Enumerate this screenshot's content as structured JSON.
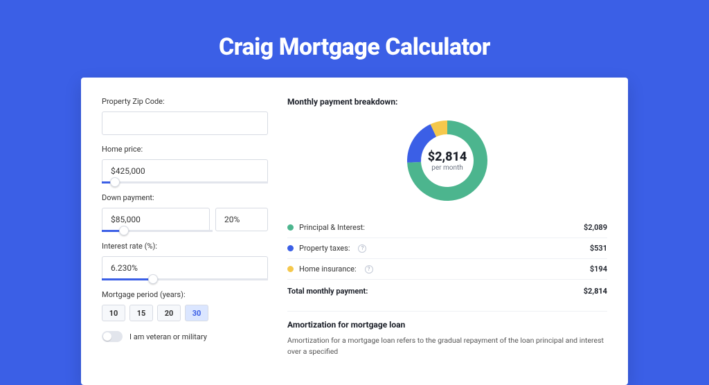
{
  "page": {
    "title": "Craig Mortgage Calculator"
  },
  "form": {
    "zip_label": "Property Zip Code:",
    "zip_value": "",
    "home_price_label": "Home price:",
    "home_price_value": "$425,000",
    "home_price_slider_pct": 8,
    "down_label": "Down payment:",
    "down_value": "$85,000",
    "down_pct_value": "20%",
    "down_slider_pct": 20,
    "rate_label": "Interest rate (%):",
    "rate_value": "6.230%",
    "rate_slider_pct": 31,
    "period_label": "Mortgage period (years):",
    "period_options": [
      "10",
      "15",
      "20",
      "30"
    ],
    "period_selected": "30",
    "veteran_label": "I am veteran or military"
  },
  "breakdown": {
    "title": "Monthly payment breakdown:",
    "center_amount": "$2,814",
    "center_sub": "per month",
    "items": [
      {
        "label": "Principal & Interest:",
        "value": "$2,089",
        "color": "#4cb58e",
        "info": false
      },
      {
        "label": "Property taxes:",
        "value": "$531",
        "color": "#3b5fe6",
        "info": true
      },
      {
        "label": "Home insurance:",
        "value": "$194",
        "color": "#f5c84c",
        "info": true
      }
    ],
    "total_label": "Total monthly payment:",
    "total_value": "$2,814"
  },
  "amort": {
    "title": "Amortization for mortgage loan",
    "desc": "Amortization for a mortgage loan refers to the gradual repayment of the loan principal and interest over a specified"
  },
  "chart_data": {
    "type": "pie",
    "title": "Monthly payment breakdown",
    "series": [
      {
        "name": "Principal & Interest",
        "value": 2089,
        "color": "#4cb58e"
      },
      {
        "name": "Property taxes",
        "value": 531,
        "color": "#3b5fe6"
      },
      {
        "name": "Home insurance",
        "value": 194,
        "color": "#f5c84c"
      }
    ],
    "total": 2814,
    "unit": "USD per month"
  }
}
